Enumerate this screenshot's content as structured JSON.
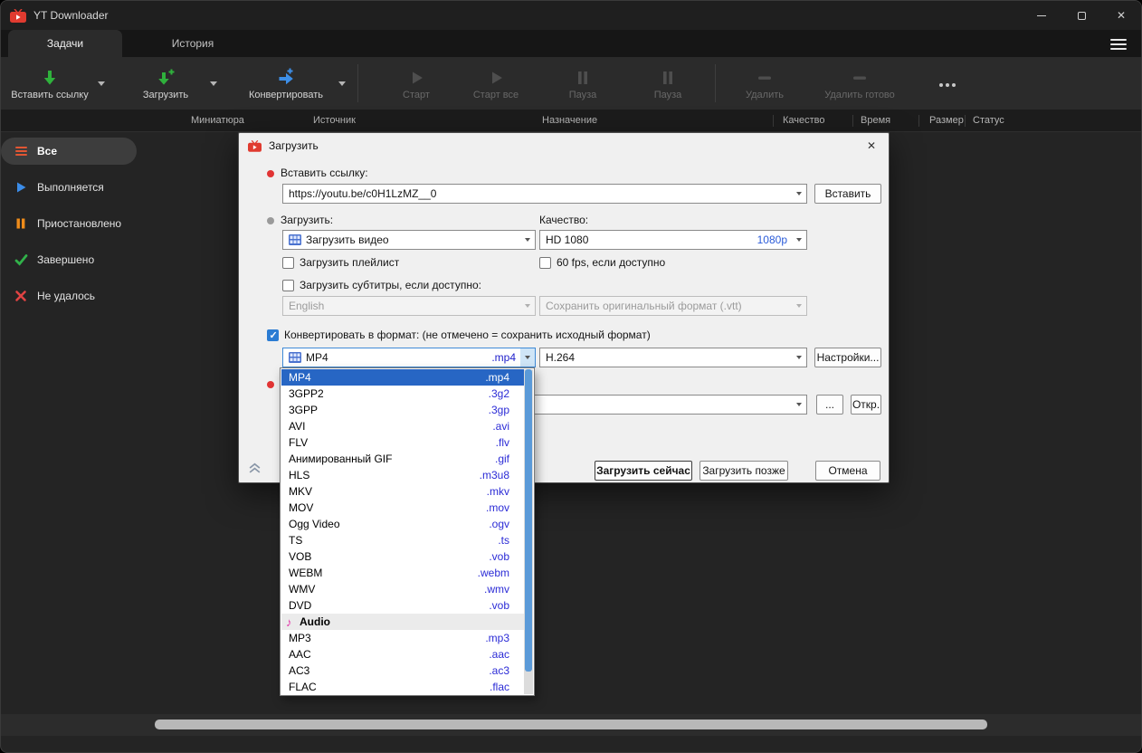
{
  "window": {
    "title": "YT Downloader"
  },
  "tabs": {
    "tasks": "Задачи",
    "history": "История"
  },
  "toolbar": {
    "paste_link": "Вставить ссылку",
    "download": "Загрузить",
    "convert": "Конвертировать",
    "start": "Старт",
    "start_all": "Старт все",
    "pause1": "Пауза",
    "pause2": "Пауза",
    "delete": "Удалить",
    "delete_done": "Удалить готово"
  },
  "columns": [
    "Миниатюра",
    "Источник",
    "Назначение",
    "Качество",
    "Время",
    "Размер",
    "Статус"
  ],
  "sidebar": {
    "all": "Все",
    "running": "Выполняется",
    "paused": "Приостановлено",
    "completed": "Завершено",
    "failed": "Не удалось"
  },
  "dialog": {
    "title": "Загрузить",
    "paste_link_label": "Вставить ссылку:",
    "url_value": "https://youtu.be/c0H1LzMZ__0",
    "paste_button": "Вставить",
    "download_label": "Загрузить:",
    "quality_label": "Качество:",
    "download_mode_value": "Загрузить видео",
    "quality_value": "HD 1080",
    "quality_tag": "1080p",
    "playlist_checkbox": "Загрузить плейлист",
    "fps_checkbox": "60 fps, если доступно",
    "subtitles_checkbox": "Загрузить субтитры, если доступно:",
    "subtitles_language_value": "English",
    "subtitles_format_value": "Сохранить оригинальный формат (.vtt)",
    "convert_checkbox": "Конвертировать в формат: (не отмечено = сохранить исходный формат)",
    "format_value": "MP4",
    "format_ext": ".mp4",
    "codec_value": "H.264",
    "settings_button": "Настройки...",
    "browse_button": "...",
    "open_button": "Откр.",
    "download_now_button": "Загрузить сейчас",
    "download_later_button": "Загрузить позже",
    "cancel_button": "Отмена"
  },
  "format_dropdown": {
    "items": [
      {
        "name": "MP4",
        "ext": ".mp4",
        "selected": true
      },
      {
        "name": "3GPP2",
        "ext": ".3g2"
      },
      {
        "name": "3GPP",
        "ext": ".3gp"
      },
      {
        "name": "AVI",
        "ext": ".avi"
      },
      {
        "name": "FLV",
        "ext": ".flv"
      },
      {
        "name": "Анимированный GIF",
        "ext": ".gif"
      },
      {
        "name": "HLS",
        "ext": ".m3u8"
      },
      {
        "name": "MKV",
        "ext": ".mkv"
      },
      {
        "name": "MOV",
        "ext": ".mov"
      },
      {
        "name": "Ogg Video",
        "ext": ".ogv"
      },
      {
        "name": "TS",
        "ext": ".ts"
      },
      {
        "name": "VOB",
        "ext": ".vob"
      },
      {
        "name": "WEBM",
        "ext": ".webm"
      },
      {
        "name": "WMV",
        "ext": ".wmv"
      },
      {
        "name": "DVD",
        "ext": ".vob"
      }
    ],
    "audio_header": "Audio",
    "audio_items": [
      {
        "name": "MP3",
        "ext": ".mp3"
      },
      {
        "name": "AAC",
        "ext": ".aac"
      },
      {
        "name": "AC3",
        "ext": ".ac3"
      },
      {
        "name": "FLAC",
        "ext": ".flac"
      }
    ]
  },
  "icons": {
    "app": "red-tv-logo",
    "menu": "hamburger",
    "paste_link": "green-down-arrow",
    "download": "green-down-arrow-plus",
    "convert": "blue-right-arrow-plus",
    "start": "play",
    "pause": "pause",
    "delete": "minus",
    "more": "ellipsis",
    "video_format": "film-strip",
    "audio_section": "music-note"
  },
  "colors": {
    "accent_blue": "#2b7cd3",
    "selection_blue": "#2766c4",
    "extension_blue": "#2222cc",
    "green": "#2fb13c",
    "orange": "#ef8c1a",
    "red": "#e13434"
  }
}
